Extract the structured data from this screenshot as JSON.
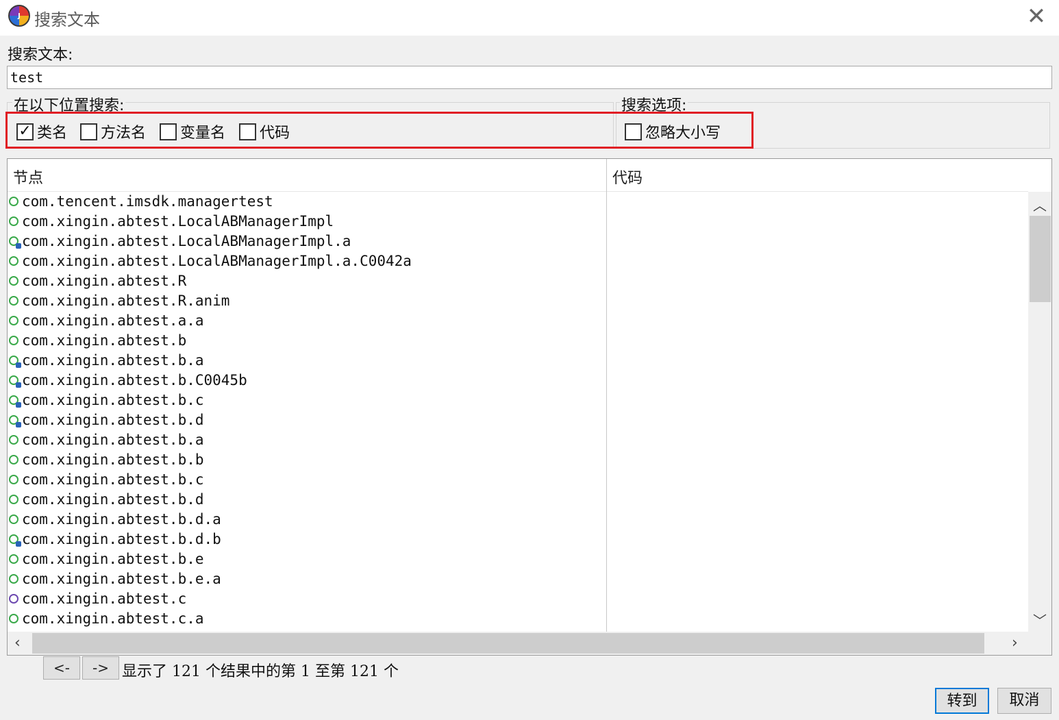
{
  "window": {
    "title": "搜索文本",
    "close_label": "✕"
  },
  "search": {
    "label": "搜索文本:",
    "value": "test"
  },
  "location_group": {
    "legend": "在以下位置搜索:",
    "options": [
      {
        "label": "类名",
        "checked": true
      },
      {
        "label": "方法名",
        "checked": false
      },
      {
        "label": "变量名",
        "checked": false
      },
      {
        "label": "代码",
        "checked": false
      }
    ]
  },
  "options_group": {
    "legend": "搜索选项:",
    "options": [
      {
        "label": "忽略大小写",
        "checked": false
      }
    ]
  },
  "results": {
    "columns": [
      "节点",
      "代码"
    ],
    "rows": [
      {
        "text": "com.tencent.imsdk.managertest",
        "icon": "class-icon"
      },
      {
        "text": "com.xingin.abtest.LocalABManagerImpl",
        "icon": "class-icon"
      },
      {
        "text": "com.xingin.abtest.LocalABManagerImpl.a",
        "icon": "inner-class-icon"
      },
      {
        "text": "com.xingin.abtest.LocalABManagerImpl.a.C0042a",
        "icon": "class-icon"
      },
      {
        "text": "com.xingin.abtest.R",
        "icon": "class-icon"
      },
      {
        "text": "com.xingin.abtest.R.anim",
        "icon": "class-icon"
      },
      {
        "text": "com.xingin.abtest.a.a",
        "icon": "class-icon"
      },
      {
        "text": "com.xingin.abtest.b",
        "icon": "class-icon"
      },
      {
        "text": "com.xingin.abtest.b.a",
        "icon": "inner-class-icon"
      },
      {
        "text": "com.xingin.abtest.b.C0045b",
        "icon": "inner-class-icon"
      },
      {
        "text": "com.xingin.abtest.b.c",
        "icon": "inner-class-icon"
      },
      {
        "text": "com.xingin.abtest.b.d",
        "icon": "inner-class-icon"
      },
      {
        "text": "com.xingin.abtest.b.a",
        "icon": "class-icon"
      },
      {
        "text": "com.xingin.abtest.b.b",
        "icon": "class-icon"
      },
      {
        "text": "com.xingin.abtest.b.c",
        "icon": "class-icon"
      },
      {
        "text": "com.xingin.abtest.b.d",
        "icon": "class-icon"
      },
      {
        "text": "com.xingin.abtest.b.d.a",
        "icon": "class-icon"
      },
      {
        "text": "com.xingin.abtest.b.d.b",
        "icon": "inner-class-icon"
      },
      {
        "text": "com.xingin.abtest.b.e",
        "icon": "class-icon"
      },
      {
        "text": "com.xingin.abtest.b.e.a",
        "icon": "class-icon"
      },
      {
        "text": "com.xingin.abtest.c",
        "icon": "interface-icon"
      },
      {
        "text": "com.xingin.abtest.c.a",
        "icon": "class-icon"
      }
    ]
  },
  "pagination": {
    "prev_label": "<-",
    "next_label": "->",
    "status": "显示了 121 个结果中的第 1 至第 121 个"
  },
  "buttons": {
    "goto_label": "转到",
    "cancel_label": "取消"
  },
  "colors": {
    "highlight": "#e01b24",
    "class_icon": "#3aa94a",
    "interface_icon": "#6d49b0",
    "primary_border": "#0078d7"
  }
}
